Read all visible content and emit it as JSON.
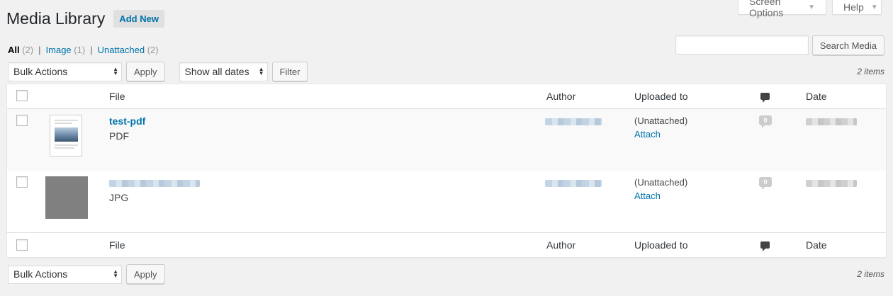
{
  "screen_options": {
    "label": "Screen Options"
  },
  "help": {
    "label": "Help"
  },
  "header": {
    "title": "Media Library",
    "add_new": "Add New"
  },
  "filters": {
    "all": {
      "label": "All",
      "count": "(2)"
    },
    "image": {
      "label": "Image",
      "count": "(1)"
    },
    "unattached": {
      "label": "Unattached",
      "count": "(2)"
    },
    "separator": "|"
  },
  "search": {
    "placeholder": "",
    "button": "Search Media"
  },
  "tablenav": {
    "bulk_actions": "Bulk Actions",
    "apply": "Apply",
    "dates": "Show all dates",
    "filter": "Filter",
    "items": "2 items"
  },
  "columns": {
    "file": "File",
    "author": "Author",
    "uploaded_to": "Uploaded to",
    "date": "Date"
  },
  "rows": [
    {
      "title": "test-pdf",
      "type": "PDF",
      "uploaded_to": "(Unattached)",
      "attach": "Attach",
      "comments": "0"
    },
    {
      "title": "",
      "type": "JPG",
      "uploaded_to": "(Unattached)",
      "attach": "Attach",
      "comments": "0"
    }
  ],
  "colors": {
    "link": "#0073aa",
    "background": "#f1f1f1"
  }
}
